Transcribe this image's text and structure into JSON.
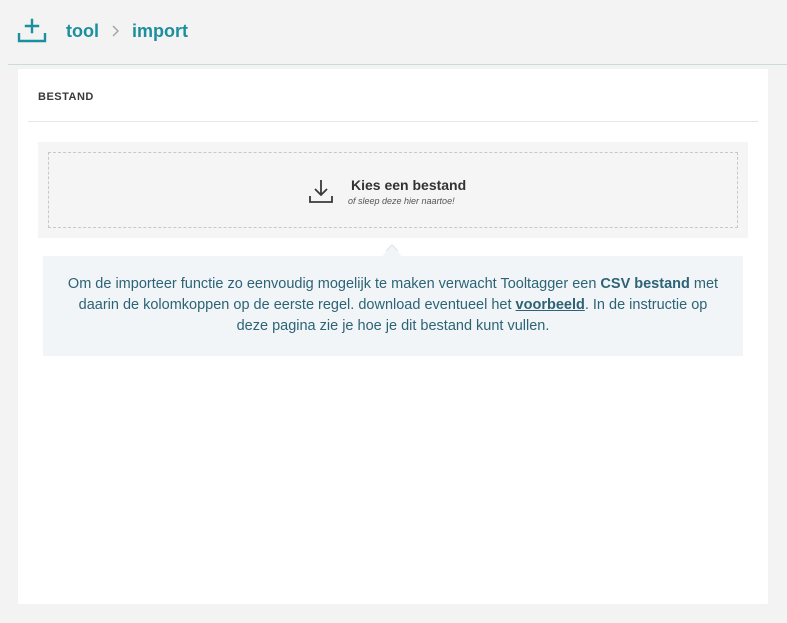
{
  "header": {
    "icon": "upload-tray-icon",
    "breadcrumb": [
      {
        "label": "tool"
      },
      {
        "label": "import"
      }
    ]
  },
  "card": {
    "title": "BESTAND"
  },
  "dropzone": {
    "icon": "download-icon",
    "title": "Kies een bestand",
    "subtitle": "of sleep deze hier naartoe!"
  },
  "info": {
    "part1": "Om de importeer functie zo eenvoudig mogelijk te maken verwacht Tooltagger een ",
    "bold": "CSV bestand",
    "part2": " met daarin de kolomkoppen op de eerste regel. download eventueel het ",
    "link": "voorbeeld",
    "part3": ". In de instructie op deze pagina zie je hoe je dit bestand kunt vullen."
  },
  "colors": {
    "accent": "#1b8f9e",
    "info_text": "#2d6375",
    "info_bg": "#f1f5f8",
    "page_bg": "#f3f3f3"
  }
}
